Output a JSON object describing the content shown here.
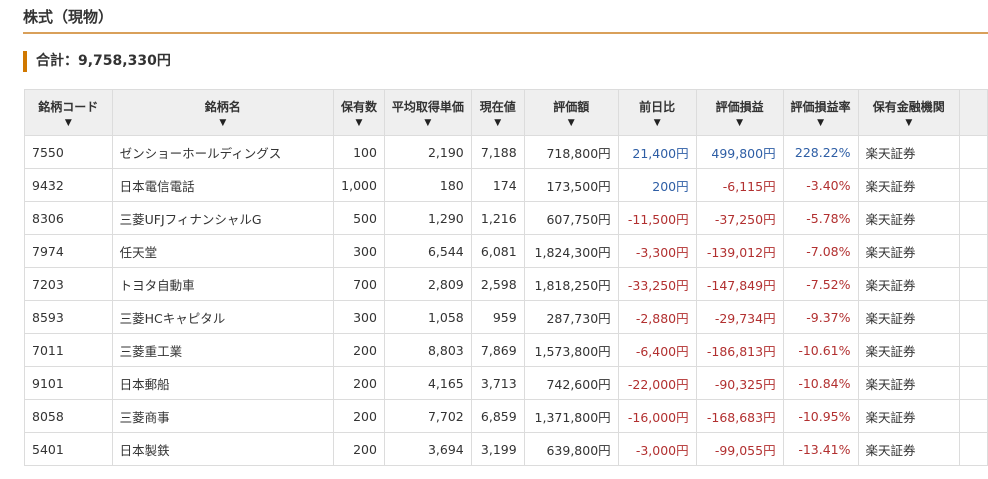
{
  "section": {
    "title": "株式（現物）"
  },
  "total": {
    "text": "合計：9,758,330円"
  },
  "colors": {
    "accent": "#d07800",
    "rule": "#d9a05a",
    "positive": "#2e5ea5",
    "negative": "#b23030"
  },
  "table": {
    "sort_icon": "▼",
    "headers": [
      "銘柄コード",
      "銘柄名",
      "保有数",
      "平均取得単価",
      "現在値",
      "評価額",
      "前日比",
      "評価損益",
      "評価損益率",
      "保有金融機関"
    ],
    "rows": [
      {
        "code": "7550",
        "name": "ゼンショーホールディングス",
        "qty": "100",
        "avg": "2,190",
        "price": "7,188",
        "value": "718,800円",
        "change": "21,400円",
        "pl": "499,800円",
        "plrate": "228.22%",
        "broker": "楽天証券",
        "change_sign": "pos",
        "pl_sign": "pos"
      },
      {
        "code": "9432",
        "name": "日本電信電話",
        "qty": "1,000",
        "avg": "180",
        "price": "174",
        "value": "173,500円",
        "change": "200円",
        "pl": "-6,115円",
        "plrate": "-3.40%",
        "broker": "楽天証券",
        "change_sign": "pos",
        "pl_sign": "neg"
      },
      {
        "code": "8306",
        "name": "三菱UFJフィナンシャルG",
        "qty": "500",
        "avg": "1,290",
        "price": "1,216",
        "value": "607,750円",
        "change": "-11,500円",
        "pl": "-37,250円",
        "plrate": "-5.78%",
        "broker": "楽天証券",
        "change_sign": "neg",
        "pl_sign": "neg"
      },
      {
        "code": "7974",
        "name": "任天堂",
        "qty": "300",
        "avg": "6,544",
        "price": "6,081",
        "value": "1,824,300円",
        "change": "-3,300円",
        "pl": "-139,012円",
        "plrate": "-7.08%",
        "broker": "楽天証券",
        "change_sign": "neg",
        "pl_sign": "neg"
      },
      {
        "code": "7203",
        "name": "トヨタ自動車",
        "qty": "700",
        "avg": "2,809",
        "price": "2,598",
        "value": "1,818,250円",
        "change": "-33,250円",
        "pl": "-147,849円",
        "plrate": "-7.52%",
        "broker": "楽天証券",
        "change_sign": "neg",
        "pl_sign": "neg"
      },
      {
        "code": "8593",
        "name": "三菱HCキャピタル",
        "qty": "300",
        "avg": "1,058",
        "price": "959",
        "value": "287,730円",
        "change": "-2,880円",
        "pl": "-29,734円",
        "plrate": "-9.37%",
        "broker": "楽天証券",
        "change_sign": "neg",
        "pl_sign": "neg"
      },
      {
        "code": "7011",
        "name": "三菱重工業",
        "qty": "200",
        "avg": "8,803",
        "price": "7,869",
        "value": "1,573,800円",
        "change": "-6,400円",
        "pl": "-186,813円",
        "plrate": "-10.61%",
        "broker": "楽天証券",
        "change_sign": "neg",
        "pl_sign": "neg"
      },
      {
        "code": "9101",
        "name": "日本郵船",
        "qty": "200",
        "avg": "4,165",
        "price": "3,713",
        "value": "742,600円",
        "change": "-22,000円",
        "pl": "-90,325円",
        "plrate": "-10.84%",
        "broker": "楽天証券",
        "change_sign": "neg",
        "pl_sign": "neg"
      },
      {
        "code": "8058",
        "name": "三菱商事",
        "qty": "200",
        "avg": "7,702",
        "price": "6,859",
        "value": "1,371,800円",
        "change": "-16,000円",
        "pl": "-168,683円",
        "plrate": "-10.95%",
        "broker": "楽天証券",
        "change_sign": "neg",
        "pl_sign": "neg"
      },
      {
        "code": "5401",
        "name": "日本製鉄",
        "qty": "200",
        "avg": "3,694",
        "price": "3,199",
        "value": "639,800円",
        "change": "-3,000円",
        "pl": "-99,055円",
        "plrate": "-13.41%",
        "broker": "楽天証券",
        "change_sign": "neg",
        "pl_sign": "neg"
      }
    ]
  }
}
